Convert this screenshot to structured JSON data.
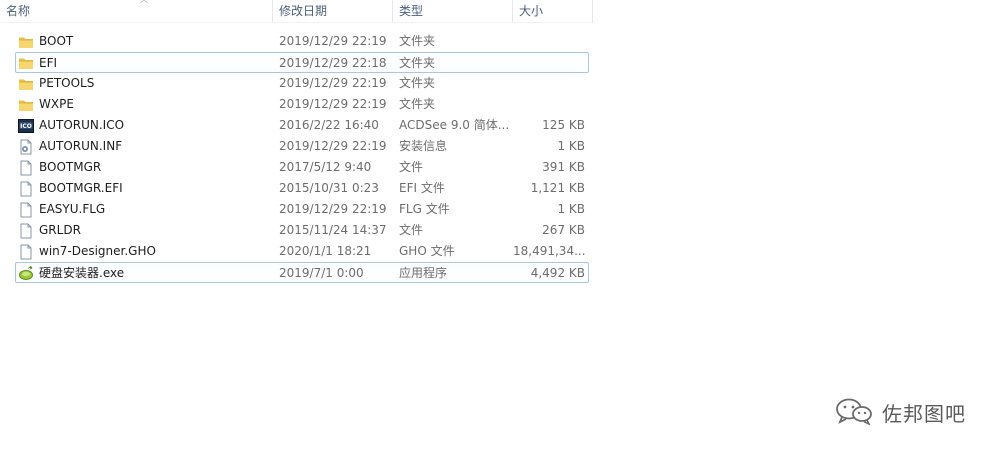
{
  "columns": {
    "name": "名称",
    "date": "修改日期",
    "type": "类型",
    "size": "大小"
  },
  "files": [
    {
      "name": "BOOT",
      "date": "2019/12/29 22:19",
      "type": "文件夹",
      "size": "",
      "icon": "folder-icon"
    },
    {
      "name": "EFI",
      "date": "2019/12/29 22:18",
      "type": "文件夹",
      "size": "",
      "icon": "folder-icon"
    },
    {
      "name": "PETOOLS",
      "date": "2019/12/29 22:19",
      "type": "文件夹",
      "size": "",
      "icon": "folder-icon"
    },
    {
      "name": "WXPE",
      "date": "2019/12/29 22:19",
      "type": "文件夹",
      "size": "",
      "icon": "folder-icon"
    },
    {
      "name": "AUTORUN.ICO",
      "date": "2016/2/22 16:40",
      "type": "ACDSee 9.0 简体...",
      "size": "125 KB",
      "icon": "ico-file-icon"
    },
    {
      "name": "AUTORUN.INF",
      "date": "2019/12/29 22:19",
      "type": "安装信息",
      "size": "1 KB",
      "icon": "settings-file-icon"
    },
    {
      "name": "BOOTMGR",
      "date": "2017/5/12 9:40",
      "type": "文件",
      "size": "391 KB",
      "icon": "file-icon"
    },
    {
      "name": "BOOTMGR.EFI",
      "date": "2015/10/31 0:23",
      "type": "EFI 文件",
      "size": "1,121 KB",
      "icon": "file-icon"
    },
    {
      "name": "EASYU.FLG",
      "date": "2019/12/29 22:19",
      "type": "FLG 文件",
      "size": "1 KB",
      "icon": "file-icon"
    },
    {
      "name": "GRLDR",
      "date": "2015/11/24 14:37",
      "type": "文件",
      "size": "267 KB",
      "icon": "file-icon"
    },
    {
      "name": "win7-Designer.GHO",
      "date": "2020/1/1 18:21",
      "type": "GHO 文件",
      "size": "18,491,34...",
      "icon": "file-icon"
    },
    {
      "name": "硬盘安装器.exe",
      "date": "2019/7/1 0:00",
      "type": "应用程序",
      "size": "4,492 KB",
      "icon": "installer-exe-icon"
    }
  ],
  "watermark": {
    "text": "佐邦图吧",
    "icon": "wechat-icon"
  },
  "colors": {
    "highlight_border": "#a9c6e6",
    "header_text": "#4c607a",
    "detail_text": "#6d6d6d"
  }
}
